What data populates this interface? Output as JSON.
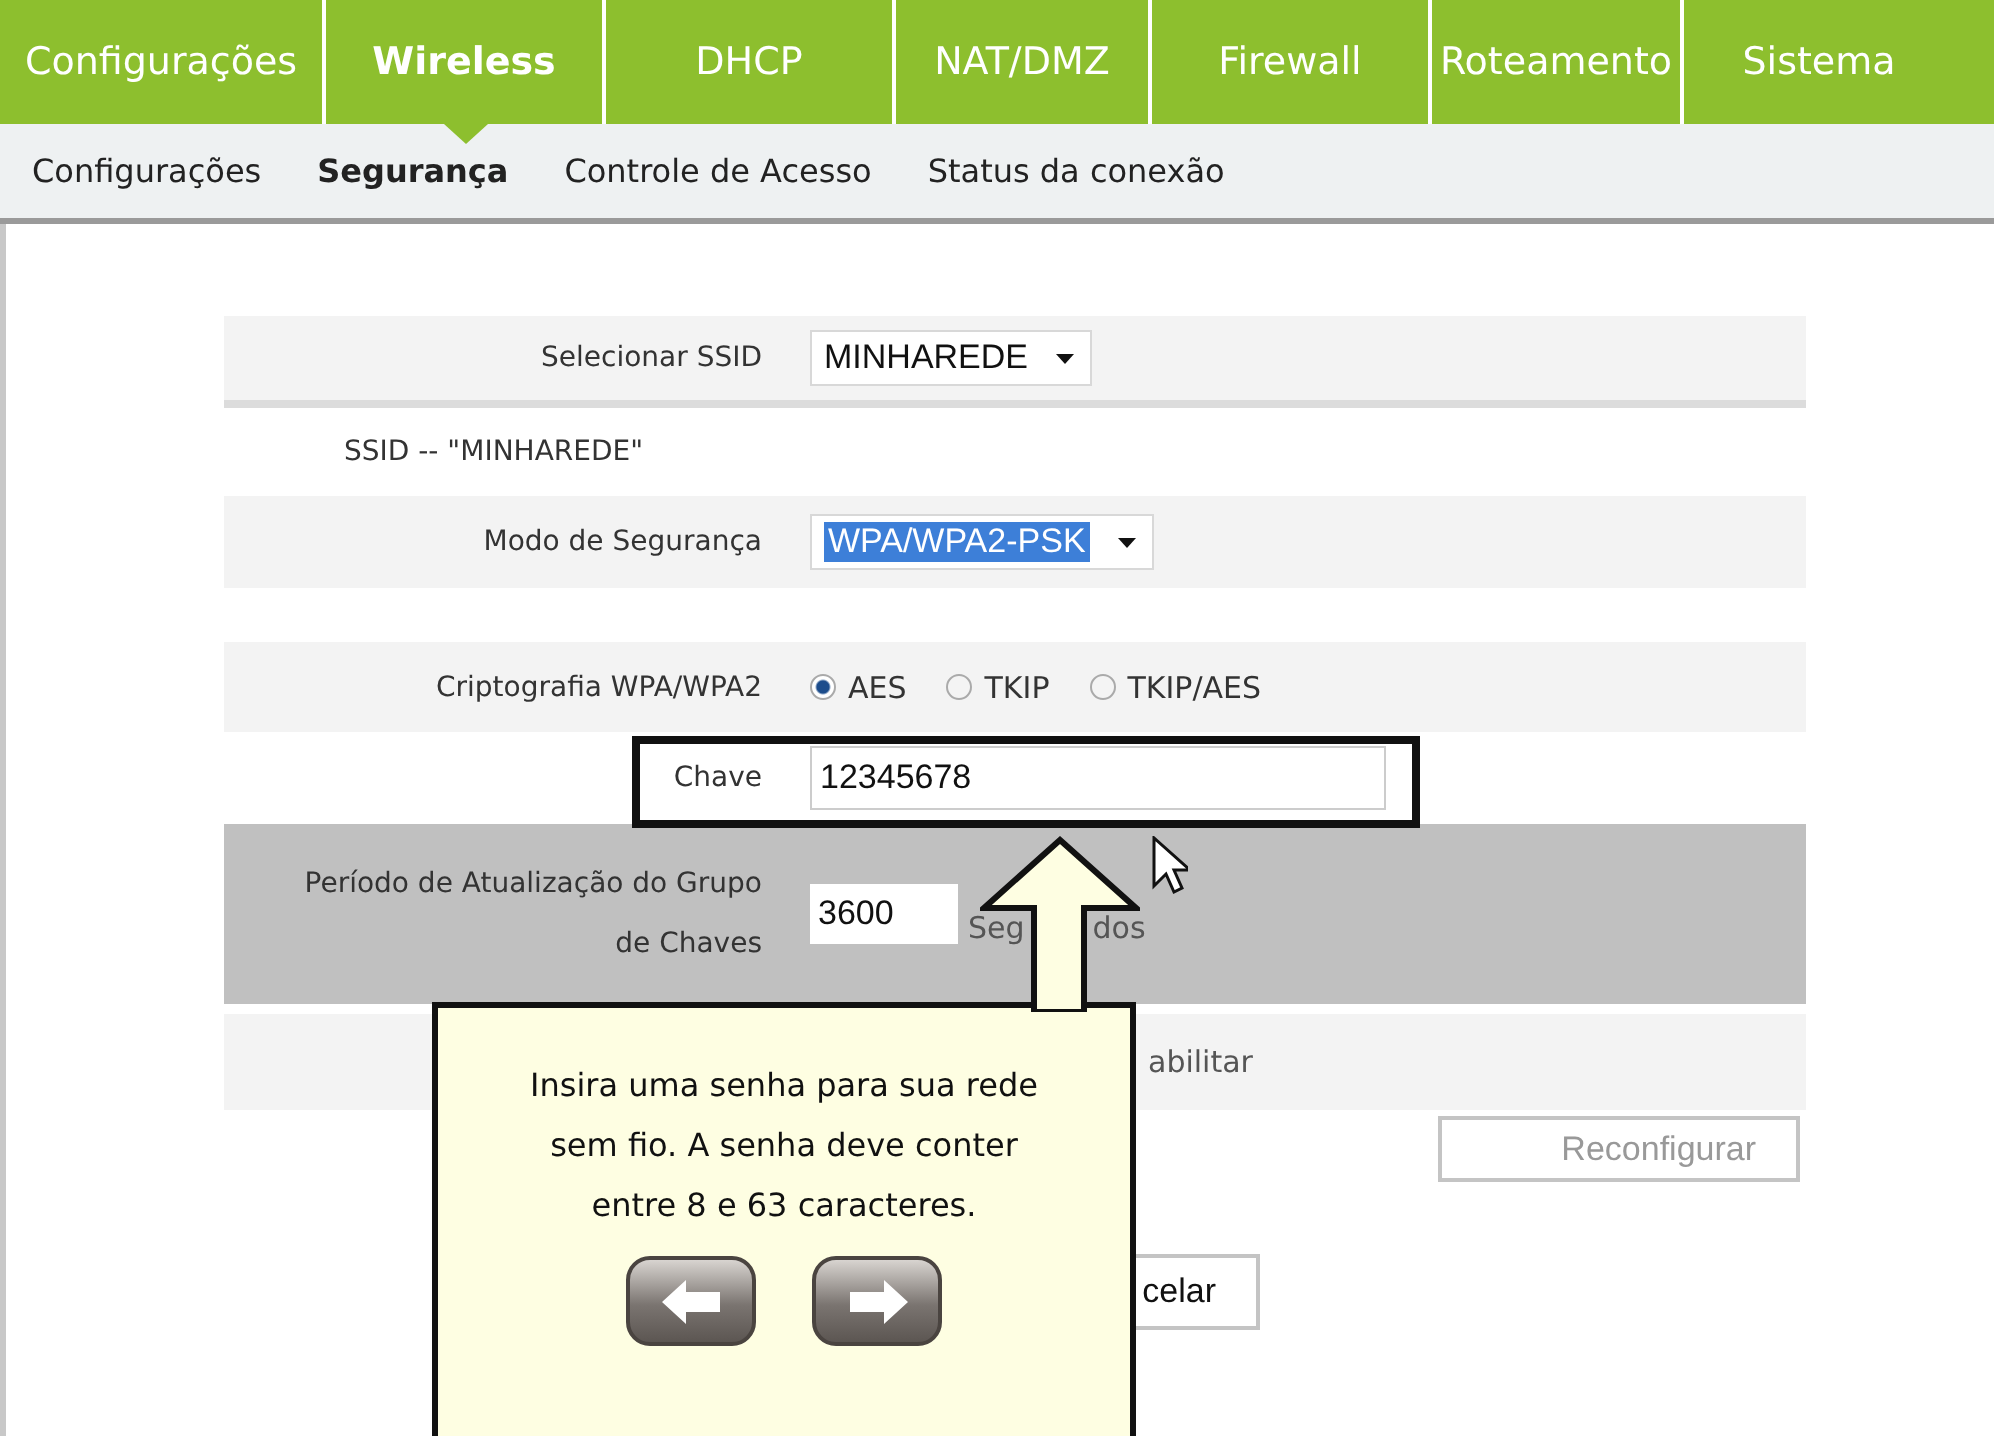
{
  "top_tabs": [
    {
      "label": "Configurações",
      "selected": false
    },
    {
      "label": "Wireless",
      "selected": true
    },
    {
      "label": "DHCP",
      "selected": false
    },
    {
      "label": "NAT/DMZ",
      "selected": false
    },
    {
      "label": "Firewall",
      "selected": false
    },
    {
      "label": "Roteamento",
      "selected": false
    },
    {
      "label": "Sistema",
      "selected": false
    }
  ],
  "sub_tabs": [
    {
      "label": "Configurações",
      "selected": false
    },
    {
      "label": "Segurança",
      "selected": true
    },
    {
      "label": "Controle de Acesso",
      "selected": false
    },
    {
      "label": "Status da conexão",
      "selected": false
    }
  ],
  "form": {
    "ssid_select": {
      "label": "Selecionar SSID",
      "value": "MINHAREDE"
    },
    "ssid_caption": "SSID -- \"MINHAREDE\"",
    "security_mode": {
      "label": "Modo de Segurança",
      "value": "WPA/WPA2-PSK",
      "highlighted": true
    },
    "encryption": {
      "label": "Criptografia WPA/WPA2",
      "options": [
        {
          "label": "AES",
          "selected": true
        },
        {
          "label": "TKIP",
          "selected": false
        },
        {
          "label": "TKIP/AES",
          "selected": false
        }
      ]
    },
    "key": {
      "label": "Chave",
      "value": "12345678"
    },
    "key_period": {
      "label": "Período de Atualização do Grupo de Chaves",
      "value": "3600",
      "unit_parts": [
        "Seg",
        "dos"
      ]
    },
    "partial_option": "abilitar",
    "reconfigure_button": {
      "label": "Reconfigurar",
      "disabled": true
    },
    "cancel_button": {
      "label": "celar"
    }
  },
  "tutorial": {
    "text": "Insira uma senha para sua rede sem fio. A senha deve conter entre 8 e 63 caracteres."
  }
}
